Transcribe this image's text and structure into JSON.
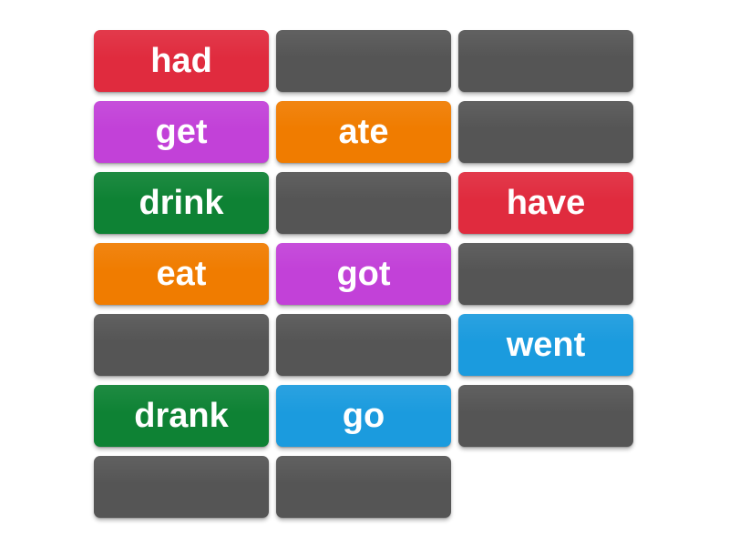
{
  "board": {
    "title": "Matching tiles board",
    "columns": 3,
    "rows": 7,
    "background_color": "#ffffff",
    "text_color": "#ffffff",
    "blank_color": "#555555",
    "palette": {
      "red": "#e02b3e",
      "purple": "#c241d8",
      "green": "#0e8234",
      "orange": "#f07c00",
      "blue": "#1b9bde",
      "gray": "#555555"
    },
    "tiles": [
      {
        "label": "had",
        "color": "#e02b3e",
        "state": "revealed"
      },
      {
        "label": "",
        "color": "#555555",
        "state": "blank"
      },
      {
        "label": "",
        "color": "#555555",
        "state": "blank"
      },
      {
        "label": "get",
        "color": "#c241d8",
        "state": "revealed"
      },
      {
        "label": "ate",
        "color": "#f07c00",
        "state": "revealed"
      },
      {
        "label": "",
        "color": "#555555",
        "state": "blank"
      },
      {
        "label": "drink",
        "color": "#0e8234",
        "state": "revealed"
      },
      {
        "label": "",
        "color": "#555555",
        "state": "blank"
      },
      {
        "label": "have",
        "color": "#e02b3e",
        "state": "revealed"
      },
      {
        "label": "eat",
        "color": "#f07c00",
        "state": "revealed"
      },
      {
        "label": "got",
        "color": "#c241d8",
        "state": "revealed"
      },
      {
        "label": "",
        "color": "#555555",
        "state": "blank"
      },
      {
        "label": "",
        "color": "#555555",
        "state": "blank"
      },
      {
        "label": "",
        "color": "#555555",
        "state": "blank"
      },
      {
        "label": "went",
        "color": "#1b9bde",
        "state": "revealed"
      },
      {
        "label": "drank",
        "color": "#0e8234",
        "state": "revealed"
      },
      {
        "label": "go",
        "color": "#1b9bde",
        "state": "revealed"
      },
      {
        "label": "",
        "color": "#555555",
        "state": "blank"
      },
      {
        "label": "",
        "color": "#555555",
        "state": "blank"
      },
      {
        "label": "",
        "color": "#555555",
        "state": "blank"
      },
      {
        "label": "",
        "color": "",
        "state": "empty"
      }
    ]
  }
}
